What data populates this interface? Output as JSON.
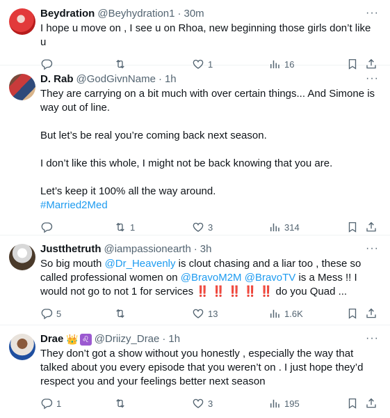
{
  "tweets": [
    {
      "name": "Beydration",
      "handle": "@Beyhydration1",
      "dot": "·",
      "time": "30m",
      "text": [
        "I hope u move on , I see u on Rhoa, new beginning those girls don’t like u"
      ],
      "hashtag": "",
      "replies": "",
      "retweets": "",
      "likes": "1",
      "views": "16"
    },
    {
      "name": "D. Rab",
      "handle": "@GodGivnName",
      "dot": "·",
      "time": "1h",
      "text": [
        "They are carrying on a bit much with over certain things... And Simone is way out of line.",
        "But let’s be real you’re coming back next season.",
        "I don’t like this whole, I might not be back knowing that you are.",
        "Let’s keep it 100% all the way around."
      ],
      "hashtag": "#Married2Med",
      "replies": "",
      "retweets": "1",
      "likes": "3",
      "views": "314"
    },
    {
      "name": "Justthetruth",
      "handle": "@iampassionearth",
      "dot": "·",
      "time": "3h",
      "text_parts": {
        "p1": "So big mouth ",
        "m1": "@Dr_Heavenly",
        "p2": "  is clout chasing and a liar too , these so called professional women on ",
        "m2": "@BravoM2M",
        "p3": " ",
        "m3": "@BravoTV",
        "p4": "  is a Mess !! I would not go to not 1 for services ",
        "bangs": "‼️ ‼️ ‼️ ‼️ ‼️",
        "p5": " do you Quad ..."
      },
      "replies": "5",
      "retweets": "",
      "likes": "13",
      "views": "1.6K"
    },
    {
      "name": "Drae",
      "handle": "@Driizy_Drae",
      "dot": "·",
      "time": "1h",
      "badges": {
        "crown": "👑",
        "leo": "♌"
      },
      "text": [
        "They don’t got a show without you honestly , especially the way that talked about you every episode that you weren’t on . I just hope they’d respect you and your feelings better next season"
      ],
      "hashtag": "",
      "replies": "1",
      "retweets": "",
      "likes": "3",
      "views": "195"
    }
  ],
  "more_glyph": "···",
  "colors": {
    "link": "#1d9bf0",
    "muted": "#536471",
    "text": "#0f1419",
    "divider": "#eff3f4"
  },
  "icons": [
    "reply-icon",
    "retweet-icon",
    "like-icon",
    "views-icon",
    "bookmark-icon",
    "share-icon"
  ]
}
